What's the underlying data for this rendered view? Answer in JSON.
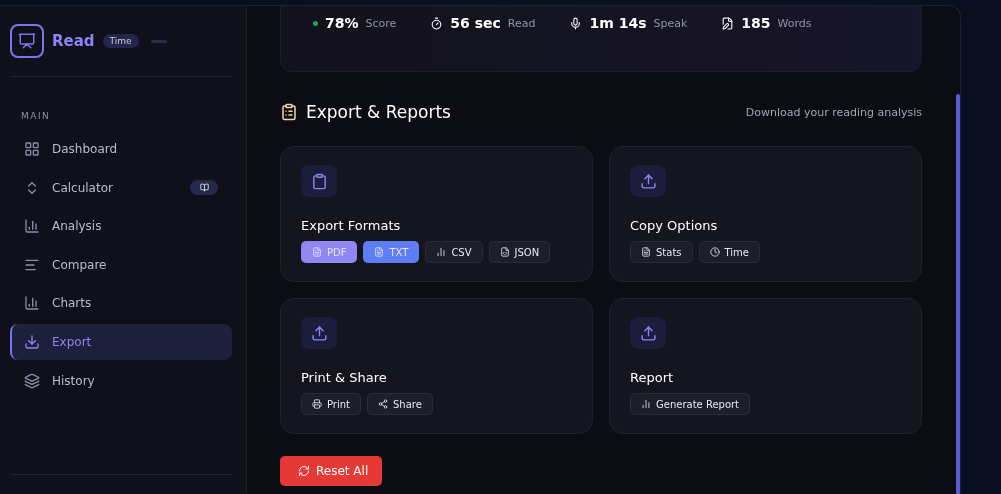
{
  "brand": {
    "name": "Read",
    "badge": "Time"
  },
  "sidebar": {
    "section": "MAIN",
    "items": [
      {
        "label": "Dashboard",
        "selected": false,
        "has_badge": false
      },
      {
        "label": "Calculator",
        "selected": false,
        "has_badge": true
      },
      {
        "label": "Analysis",
        "selected": false,
        "has_badge": false
      },
      {
        "label": "Compare",
        "selected": false,
        "has_badge": false
      },
      {
        "label": "Charts",
        "selected": false,
        "has_badge": false
      },
      {
        "label": "Export",
        "selected": true,
        "has_badge": false
      },
      {
        "label": "History",
        "selected": false,
        "has_badge": false
      }
    ]
  },
  "stats": [
    {
      "value": "78%",
      "label": "Score",
      "color": "#22a55a"
    },
    {
      "value": "56 sec",
      "label": "Read"
    },
    {
      "value": "1m 14s",
      "label": "Speak"
    },
    {
      "value": "185",
      "label": "Words"
    }
  ],
  "section": {
    "title": "Export & Reports",
    "subtitle": "Download your reading analysis"
  },
  "cards": [
    {
      "title": "Export Formats",
      "buttons": [
        {
          "label": "PDF",
          "kind": "purple"
        },
        {
          "label": "TXT",
          "kind": "blue"
        },
        {
          "label": "CSV",
          "kind": "plain"
        },
        {
          "label": "JSON",
          "kind": "plain"
        }
      ]
    },
    {
      "title": "Copy Options",
      "buttons": [
        {
          "label": "Stats",
          "kind": "plain"
        },
        {
          "label": "Time",
          "kind": "plain"
        }
      ]
    },
    {
      "title": "Print & Share",
      "buttons": [
        {
          "label": "Print",
          "kind": "plain"
        },
        {
          "label": "Share",
          "kind": "plain"
        }
      ]
    },
    {
      "title": "Report",
      "buttons": [
        {
          "label": "Generate Report",
          "kind": "plain"
        }
      ]
    }
  ],
  "reset_button": "Reset All"
}
